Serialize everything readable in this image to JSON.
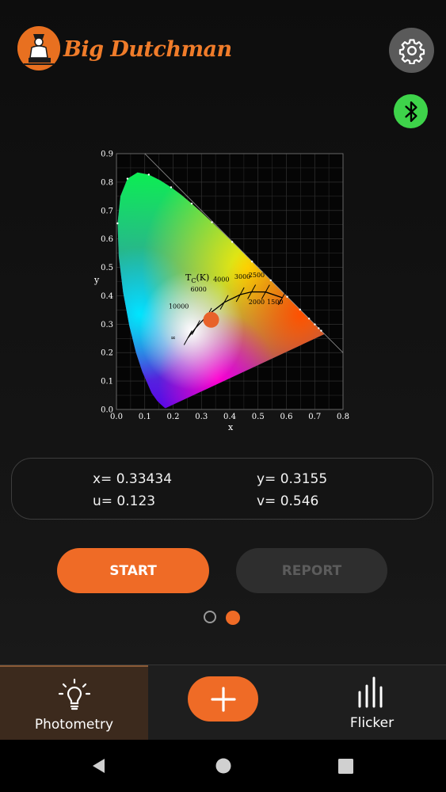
{
  "header": {
    "brand_text": "Big Dutchman",
    "settings_icon": "gear-icon",
    "bluetooth_icon": "bluetooth-icon",
    "bluetooth_color": "#3ed34a"
  },
  "chart_data": {
    "type": "scatter",
    "subtype": "cie-1931-chromaticity-diagram",
    "xlabel": "x",
    "ylabel": "y",
    "xlim": [
      0.0,
      0.8
    ],
    "ylim": [
      0.0,
      0.9
    ],
    "x_ticks": [
      "0.0",
      "0.1",
      "0.2",
      "0.3",
      "0.4",
      "0.5",
      "0.6",
      "0.7",
      "0.8"
    ],
    "y_ticks": [
      "0.0",
      "0.1",
      "0.2",
      "0.3",
      "0.4",
      "0.5",
      "0.6",
      "0.7",
      "0.8",
      "0.9"
    ],
    "grid": true,
    "planckian_locus": {
      "title_prefix": "T",
      "title_sub": "C",
      "title_suffix": "(K)",
      "labels": [
        "10000",
        "6000",
        "4000",
        "3000",
        "2500",
        "2000",
        "1500",
        "∞"
      ]
    },
    "measured_point": {
      "x": 0.33434,
      "y": 0.3155,
      "color": "#e8622a"
    }
  },
  "values": {
    "x": "x= 0.33434",
    "y": "y= 0.3155",
    "u": "u= 0.123",
    "v": "v= 0.546"
  },
  "buttons": {
    "start": "START",
    "report": "REPORT"
  },
  "tabs": {
    "photometry": "Photometry",
    "flicker": "Flicker",
    "photometry_icon": "lightbulb-icon",
    "add_icon": "plus-icon",
    "flicker_icon": "bar-chart-icon"
  },
  "accent_color": "#ef6b26"
}
